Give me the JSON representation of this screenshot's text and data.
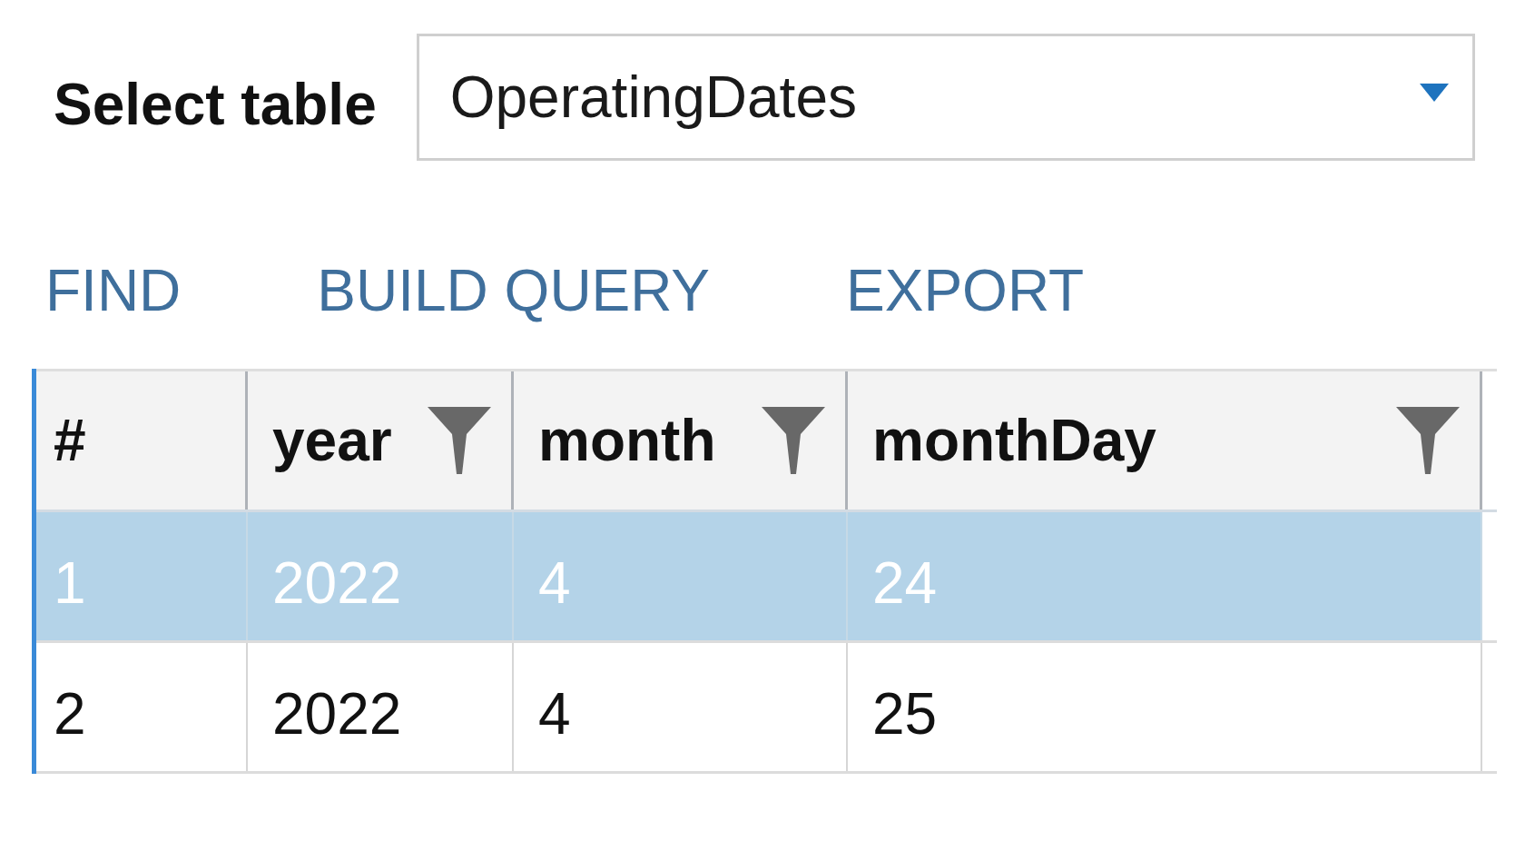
{
  "table_picker": {
    "label": "Select table",
    "value": "OperatingDates"
  },
  "actions": [
    {
      "label": "FIND"
    },
    {
      "label": "BUILD QUERY"
    },
    {
      "label": "EXPORT"
    }
  ],
  "table": {
    "columns": [
      {
        "label": "#",
        "filter": false
      },
      {
        "label": "year",
        "filter": true
      },
      {
        "label": "month",
        "filter": true
      },
      {
        "label": "monthDay",
        "filter": true
      }
    ],
    "rows": [
      {
        "selected": true,
        "cells": [
          "1",
          "2022",
          "4",
          "24"
        ]
      },
      {
        "selected": false,
        "cells": [
          "2",
          "2022",
          "4",
          "25"
        ]
      }
    ]
  }
}
